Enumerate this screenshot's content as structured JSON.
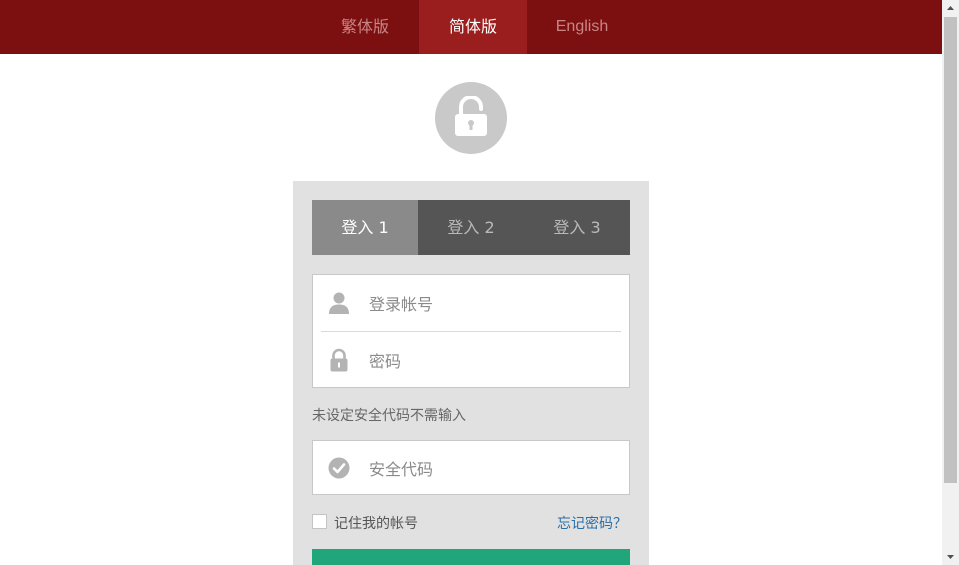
{
  "language_bar": {
    "items": [
      {
        "label": "繁体版",
        "active": false
      },
      {
        "label": "简体版",
        "active": true
      },
      {
        "label": "English",
        "active": false
      }
    ]
  },
  "login": {
    "tabs": [
      {
        "label": "登入 1",
        "active": true
      },
      {
        "label": "登入 2",
        "active": false
      },
      {
        "label": "登入 3",
        "active": false
      }
    ],
    "account_placeholder": "登录帐号",
    "password_placeholder": "密码",
    "security_hint": "未设定安全代码不需输入",
    "security_code_placeholder": "安全代码",
    "remember_label": "记住我的帐号",
    "forgot_label": "忘记密码？"
  },
  "colors": {
    "header_bg": "#7c0f10",
    "active_lang_bg": "#9a1e1d",
    "login_button": "#21a57a",
    "link": "#2a6ea6"
  }
}
